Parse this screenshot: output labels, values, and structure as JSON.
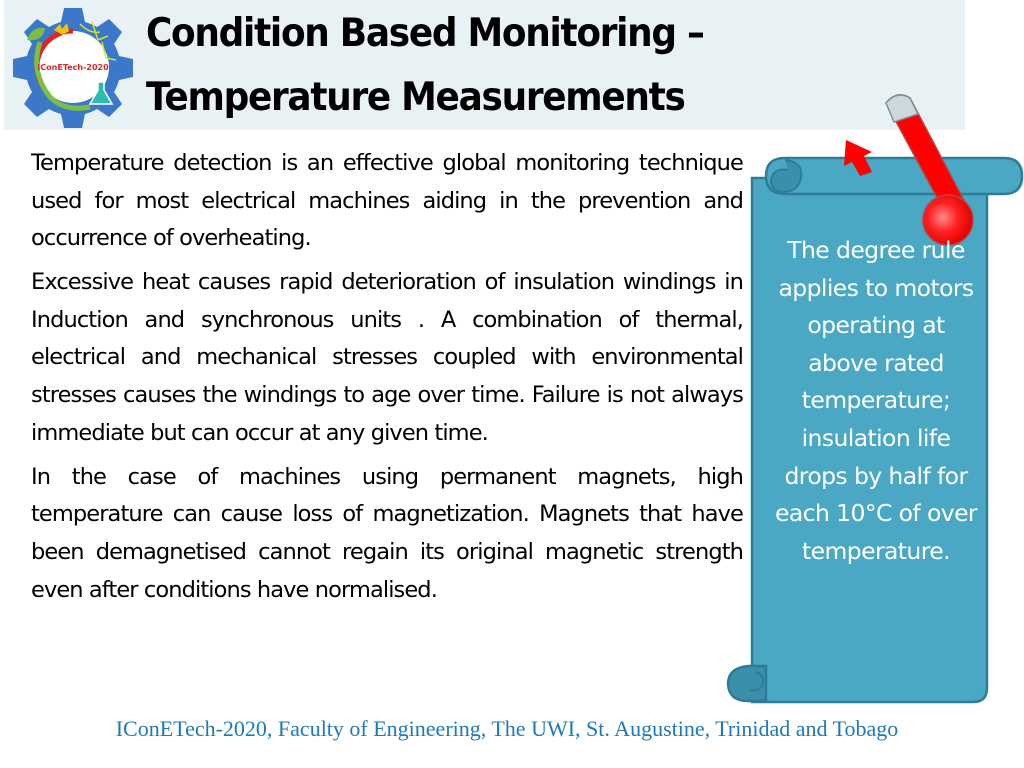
{
  "header": {
    "logo_text": "IConETech-2020",
    "title_lines": [
      "Condition Based Monitoring –",
      "Temperature Measurements"
    ]
  },
  "body": {
    "paragraphs": [
      "Temperature detection is an effective global monitoring technique used for most electrical machines aiding in the prevention and occurrence of overheating.",
      "Excessive heat causes rapid deterioration of insulation windings in Induction and synchronous units . A combination of thermal, electrical and mechanical stresses coupled with environmental stresses causes the windings to age over time. Failure is not always immediate but can occur at any given time.",
      "In the case of machines using permanent magnets, high temperature can cause loss of magnetization. Magnets that have been demagnetised cannot regain its original magnetic strength even after conditions have normalised."
    ]
  },
  "callout": {
    "text": "The degree rule applies to motors operating at above rated temperature; insulation life drops by half for each 10°C of over temperature.",
    "icons": [
      "scroll-icon",
      "thermometer-icon",
      "up-arrow-icon"
    ]
  },
  "colors": {
    "header_band": "#e8f2f5",
    "scroll_fill": "#4aa8c5",
    "scroll_outline": "#2e7d96",
    "thermometer_red": "#ff0000",
    "footer_text": "#1f78b8"
  },
  "footer": {
    "text": "IConETech-2020, Faculty of Engineering, The UWI, St. Augustine, Trinidad and Tobago"
  }
}
